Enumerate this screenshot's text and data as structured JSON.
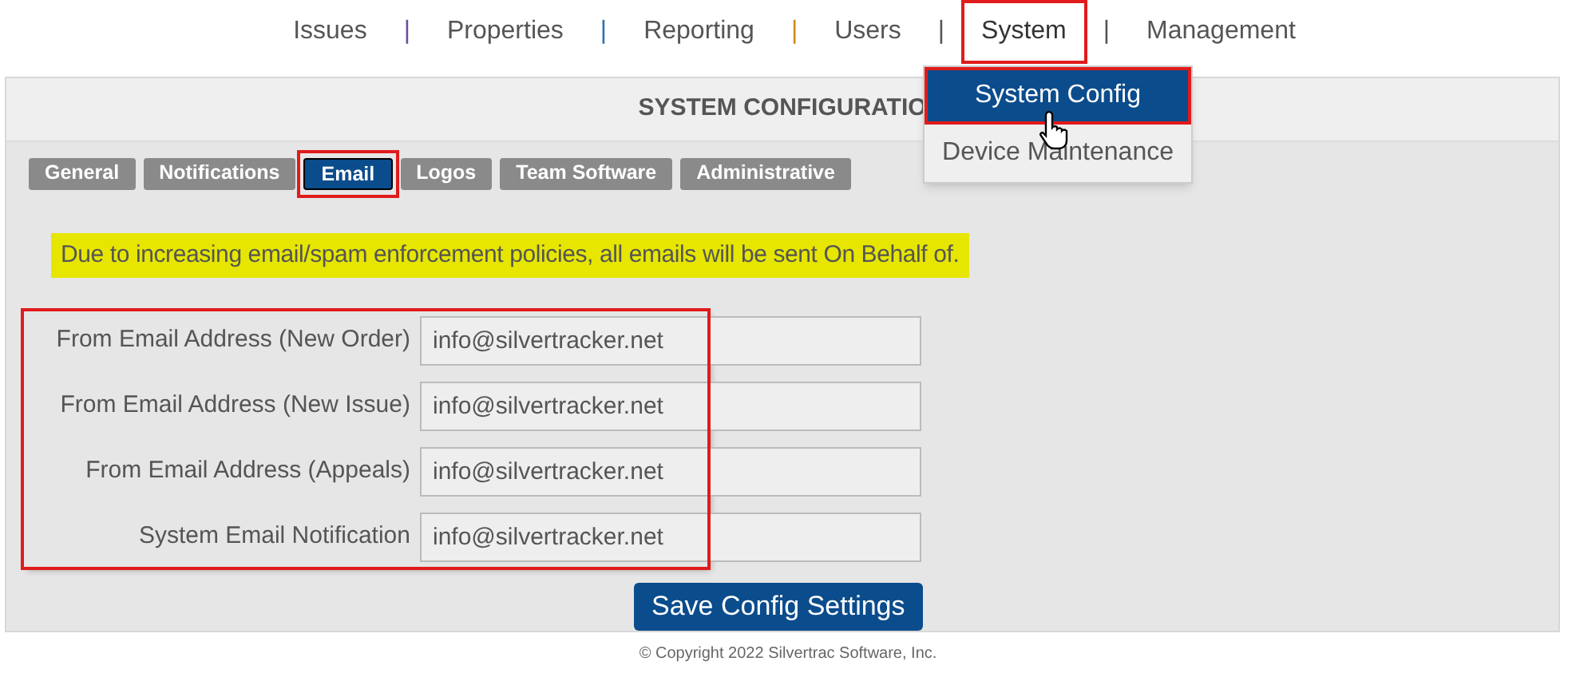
{
  "nav": [
    {
      "kind": "link",
      "label": "Issues",
      "selected": false,
      "highlighted": false
    },
    {
      "kind": "separator",
      "label": "|",
      "color": "#6b4f9e"
    },
    {
      "kind": "link",
      "label": "Properties",
      "selected": false,
      "highlighted": false
    },
    {
      "kind": "separator",
      "label": "|",
      "color": "#2f6fb3"
    },
    {
      "kind": "link",
      "label": "Reporting",
      "selected": false,
      "highlighted": false
    },
    {
      "kind": "separator",
      "label": "|",
      "color": "#d08a1c"
    },
    {
      "kind": "link",
      "label": "Users",
      "selected": false,
      "highlighted": false
    },
    {
      "kind": "separator",
      "label": "|",
      "color": "#555555"
    },
    {
      "kind": "link",
      "label": "System",
      "selected": true,
      "highlighted": true
    },
    {
      "kind": "separator",
      "label": "|",
      "color": "#555555"
    },
    {
      "kind": "link",
      "label": "Management",
      "selected": false,
      "highlighted": false
    }
  ],
  "dropdown": [
    {
      "label": "System Config",
      "selected": true,
      "highlighted": true
    },
    {
      "label": "Device Maintenance",
      "selected": false,
      "highlighted": false
    }
  ],
  "panel": {
    "title": "SYSTEM CONFIGURATIO",
    "tabs": [
      {
        "label": "General",
        "selected": false,
        "highlighted": false
      },
      {
        "label": "Notifications",
        "selected": false,
        "highlighted": false
      },
      {
        "label": "Email",
        "selected": true,
        "highlighted": true
      },
      {
        "label": "Logos",
        "selected": false,
        "highlighted": false
      },
      {
        "label": "Team Software",
        "selected": false,
        "highlighted": false
      },
      {
        "label": "Administrative",
        "selected": false,
        "highlighted": false
      }
    ],
    "notice": "Due to increasing email/spam enforcement policies, all emails will be sent On Behalf of.",
    "fields_highlighted": true,
    "fields": [
      {
        "label": "From Email Address (New Order)",
        "value": "info@silvertracker.net"
      },
      {
        "label": "From Email Address (New Issue)",
        "value": "info@silvertracker.net"
      },
      {
        "label": "From Email Address (Appeals)",
        "value": "info@silvertracker.net"
      },
      {
        "label": "System Email Notification",
        "value": "info@silvertracker.net"
      }
    ],
    "save_button": "Save Config Settings"
  },
  "footer": "© Copyright 2022 Silvertrac Software, Inc."
}
